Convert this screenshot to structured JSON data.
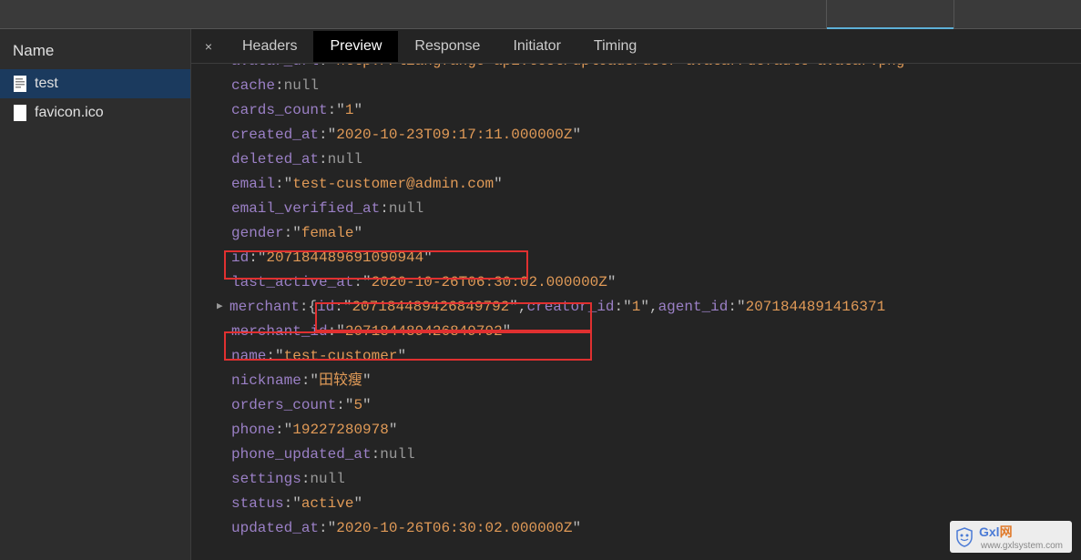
{
  "sidebar": {
    "header": "Name",
    "items": [
      {
        "label": "test",
        "selected": true,
        "icon": "doc-icon"
      },
      {
        "label": "favicon.ico",
        "selected": false,
        "icon": "blank-icon"
      }
    ]
  },
  "tabs": {
    "close_glyph": "×",
    "items": [
      {
        "label": "Headers",
        "active": false
      },
      {
        "label": "Preview",
        "active": true
      },
      {
        "label": "Response",
        "active": false
      },
      {
        "label": "Initiator",
        "active": false
      },
      {
        "label": "Timing",
        "active": false
      }
    ]
  },
  "preview": {
    "avatar_url_key": "avatar_url",
    "avatar_url_val": "http://liangfango-api.test/uploads/user-avatar/default-avatar.png",
    "cache_key": "cache",
    "cache_val_null": "null",
    "cards_count_key": "cards_count",
    "cards_count_val": "1",
    "created_at_key": "created_at",
    "created_at_val": "2020-10-23T09:17:11.000000Z",
    "deleted_at_key": "deleted_at",
    "deleted_at_null": "null",
    "email_key": "email",
    "email_val": "test-customer@admin.com",
    "email_verified_at_key": "email_verified_at",
    "email_verified_null": "null",
    "gender_key": "gender",
    "gender_val": "female",
    "id_key": "id",
    "id_val": "207184489691090944",
    "last_active_at_key": "last_active_at",
    "last_active_at_val": "2020-10-26T06:30:02.000000Z",
    "merchant_key": "merchant",
    "merchant_inner_id_key": "id",
    "merchant_inner_id_val": "207184489426849792",
    "merchant_inner_creator_key": "creator_id",
    "merchant_inner_creator_val": "1",
    "merchant_inner_agent_key": "agent_id",
    "merchant_inner_agent_val": "2071844891416371",
    "merchant_id_key": "merchant_id",
    "merchant_id_val": "207184489426849792",
    "name_key": "name",
    "name_val": "test-customer",
    "nickname_key": "nickname",
    "nickname_val": "田较瘦",
    "orders_count_key": "orders_count",
    "orders_count_val": "5",
    "phone_key": "phone",
    "phone_val": "19227280978",
    "phone_updated_at_key": "phone_updated_at",
    "phone_updated_null": "null",
    "settings_key": "settings",
    "settings_null": "null",
    "status_key": "status",
    "status_val": "active",
    "updated_at_key": "updated_at",
    "updated_at_val": "2020-10-26T06:30:02.000000Z"
  },
  "watermark": {
    "brand": "Gxl",
    "brand2": "网",
    "url": "www.gxlsystem.com"
  }
}
